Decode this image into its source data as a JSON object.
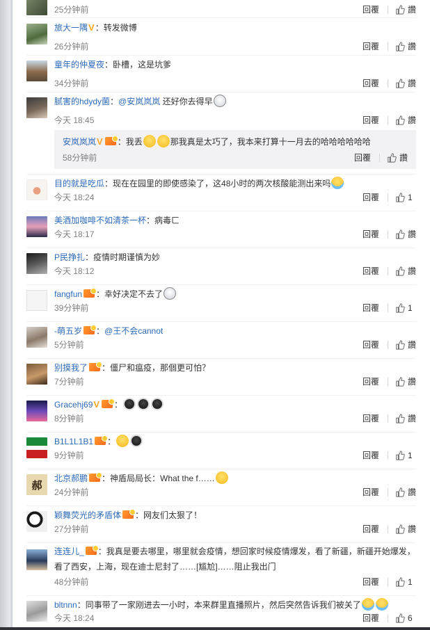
{
  "ui": {
    "reply": "回覆",
    "like": "讚"
  },
  "comments": [
    {
      "user": "",
      "text": "",
      "time": "25分钟前",
      "like": "讚"
    },
    {
      "user": "旅大一隅",
      "v": true,
      "text": "：转发微博",
      "time": "26分钟前",
      "like": "讚"
    },
    {
      "user": "童年的仲夏夜",
      "text": "：卧槽，这是坑爹",
      "time": "34分钟前",
      "like": "讚"
    },
    {
      "user": "腻害的hdydy菌",
      "text": "：",
      "mention": "@安岚岚岚",
      "text2": " 还好你去得早",
      "time": "今天 18:45",
      "like": "讚"
    },
    {
      "user": "目的就是吃瓜",
      "text": "：现在在园里的即使感染了，这48小时的两次核酸能测出来吗",
      "time": "今天 18:24",
      "like": "1"
    },
    {
      "user": "美酒加咖啡不如清茶一杯",
      "text": "：病毒ㄈ",
      "time": "今天 18:17",
      "like": "讚"
    },
    {
      "user": "P民挣扎",
      "text": "：疫情时期谨慎为妙",
      "time": "今天 18:12",
      "like": "讚"
    },
    {
      "user": "fangfun",
      "text": "：幸好决定不去了",
      "time": "39分钟前",
      "like": "1"
    },
    {
      "user": "-萌五岁",
      "text": "：",
      "mention": "@王不会cannot",
      "time": "5分钟前",
      "like": "讚"
    },
    {
      "user": "别摸我了",
      "text": "：僵尸和瘟疫，那個更可怕？",
      "time": "7分钟前",
      "like": "讚"
    },
    {
      "user": "Gracehj69",
      "v": true,
      "text": "：",
      "time": "8分钟前",
      "like": "讚"
    },
    {
      "user": "B1L1L1B1",
      "text": "：",
      "time": "9分钟前",
      "like": "1"
    },
    {
      "user": "北京郝鹏",
      "text": "：神盾局局长：What the f……",
      "time": "24分钟前",
      "like": "讚"
    },
    {
      "user": "颖舞荧光的矛盾体",
      "text": "：网友们太狠了！",
      "time": "27分钟前",
      "like": "讚"
    },
    {
      "user": "连连儿_",
      "text": "：我真是要去哪里，哪里就会疫情，想回家时候疫情爆发，看了新疆，新疆开始爆发，看了西安，上海，现在迪士尼封了……[尴尬]……阻止我出门",
      "time": "48分钟前",
      "like": "1"
    },
    {
      "user": "bltnnn",
      "text": "：同事带了一家刚进去一小时，本来群里直播照片，然后突然告诉我们被关了",
      "time": "今天 18:24",
      "like": "6"
    }
  ],
  "nested": {
    "user": "安岚岚岚",
    "v": true,
    "text": "：我丢",
    "text2": "那我真是太巧了，我本来打算十一月去的哈哈哈哈哈哈",
    "time": "58分钟前",
    "like": "讚"
  },
  "avatar_text": {
    "beijing": "郝"
  },
  "colors": {
    "link": "#2d6ab8",
    "meta": "#808080",
    "badge": "#f76b1c",
    "v": "#f5a623"
  }
}
